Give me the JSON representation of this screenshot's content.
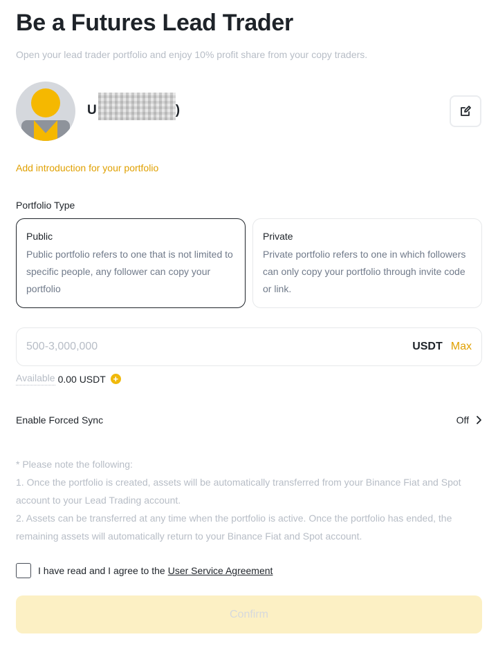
{
  "header": {
    "title": "Be a Futures Lead Trader",
    "subtitle": "Open your lead trader portfolio and enjoy 10% profit share from your copy traders."
  },
  "profile": {
    "username_visible_prefix": "U",
    "username_visible_suffix": ")",
    "avatar_icon": "default-avatar",
    "edit_icon": "edit-icon"
  },
  "intro_link": "Add introduction for your portfolio",
  "portfolio_type": {
    "label": "Portfolio Type",
    "selected": "Public",
    "options": [
      {
        "title": "Public",
        "description": "Public portfolio refers to one that is not limited to specific people, any follower can copy your portfolio"
      },
      {
        "title": "Private",
        "description": "Private portfolio refers to one in which followers can only copy your portfolio through invite code or link."
      }
    ]
  },
  "amount": {
    "placeholder": "500-3,000,000",
    "unit": "USDT",
    "max_label": "Max"
  },
  "available": {
    "label": "Available",
    "value": "0.00 USDT",
    "add_icon": "plus-circle-icon"
  },
  "forced_sync": {
    "label": "Enable Forced Sync",
    "value": "Off"
  },
  "notes": {
    "heading": "* Please note the following:",
    "items": [
      "1. Once the portfolio is created, assets will be automatically transferred from your Binance Fiat and Spot account to your Lead Trading account.",
      "2. Assets can be transferred at any time when the portfolio is active. Once the portfolio has ended, the remaining assets will automatically return to your Binance Fiat and Spot account."
    ]
  },
  "agreement": {
    "text": "I have read and I agree to the",
    "link": "User Service Agreement",
    "checked": false
  },
  "confirm_label": "Confirm",
  "colors": {
    "accent": "#f0b90b",
    "link": "#e0a000",
    "confirm_disabled_bg": "#fcf0c4",
    "muted_text": "#b7bdc6"
  }
}
